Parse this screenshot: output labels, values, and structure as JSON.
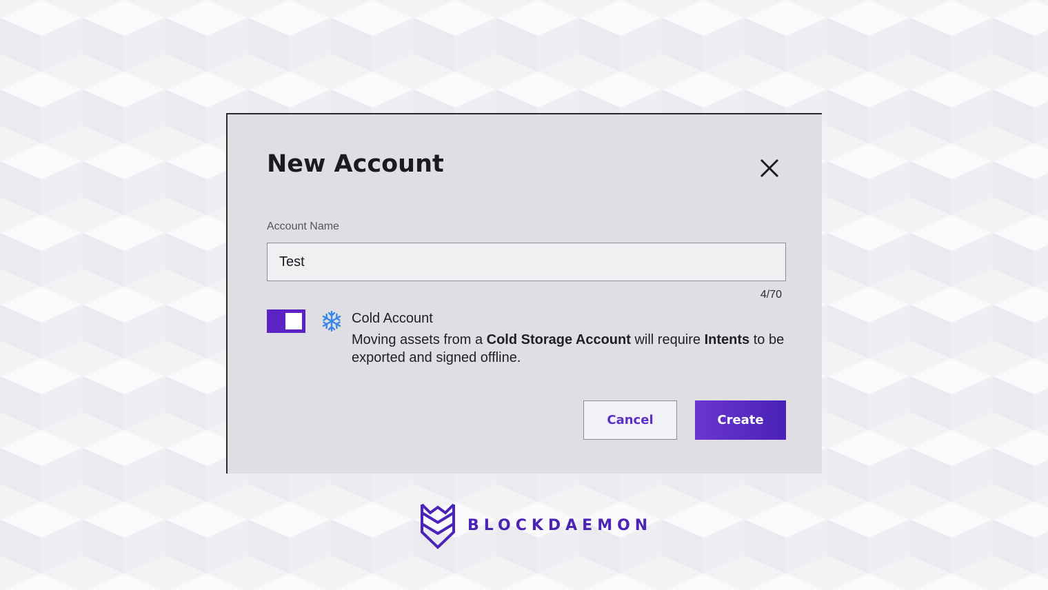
{
  "dialog": {
    "title": "New Account",
    "close_icon": "close-icon",
    "account_name": {
      "label": "Account Name",
      "value": "Test",
      "char_count": "4/70"
    },
    "cold_account": {
      "toggle_on": true,
      "icon": "snowflake-icon",
      "title": "Cold Account",
      "description_prefix": "Moving assets from a ",
      "description_bold_1": "Cold Storage Account",
      "description_middle": " will require ",
      "description_bold_2": "Intents",
      "description_suffix": " to be exported and signed offline."
    },
    "buttons": {
      "cancel_label": "Cancel",
      "create_label": "Create"
    }
  },
  "brand": {
    "name": "BLOCKDAEMON",
    "logo_icon": "blockdaemon-logo-icon",
    "color": "#4b23b5"
  },
  "colors": {
    "accent": "#5b22c6",
    "snowflake": "#3a86e8",
    "dialog_bg": "#dfdee3",
    "page_bg": "#f2f1f5"
  }
}
